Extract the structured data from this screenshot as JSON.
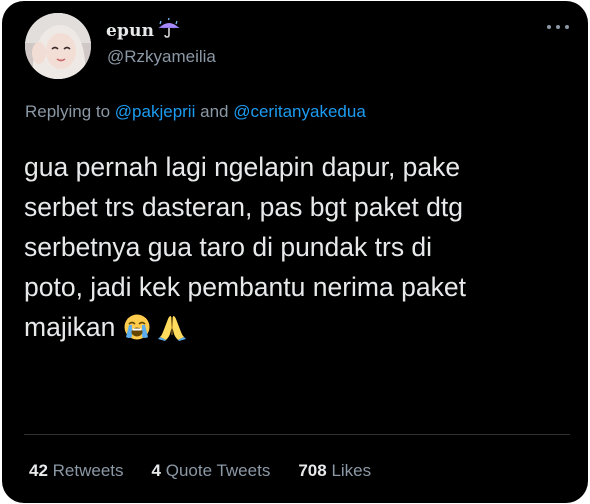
{
  "tweet": {
    "author": {
      "display_name": "epun",
      "name_emoji": "umbrella-with-rain-icon",
      "handle": "@Rzkyameilia"
    },
    "reply": {
      "prefix": "Replying to",
      "mention_1": "@pakjeprii",
      "connector": "and",
      "mention_2": "@ceritanyakedua"
    },
    "text_lines": [
      "gua pernah lagi ngelapin dapur, pake",
      "serbet trs dasteran, pas bgt paket dtg",
      "serbetnya gua taro di pundak trs di",
      "poto, jadi kek pembantu nerima paket",
      "majikan"
    ],
    "trailing_emojis": [
      "loudly-crying-face-icon",
      "folded-hands-icon"
    ],
    "stats": {
      "retweets_count": "42",
      "retweets_label": "Retweets",
      "quotes_count": "4",
      "quotes_label": "Quote Tweets",
      "likes_count": "708",
      "likes_label": "Likes"
    }
  },
  "colors": {
    "background": "#000000",
    "primary_text": "#e7e9ea",
    "secondary_text": "#8b98a5",
    "link": "#1d9bf0",
    "divider": "#2f3336"
  }
}
